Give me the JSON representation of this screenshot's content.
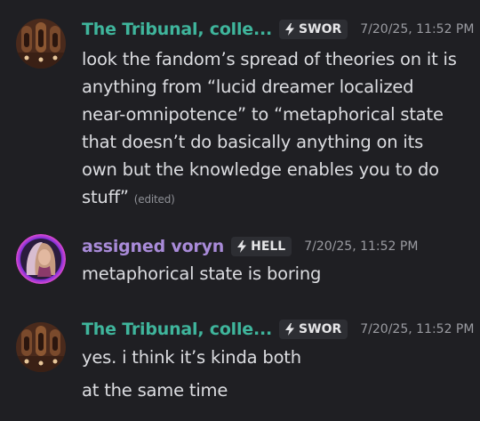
{
  "messages": [
    {
      "username": "The Tribunal, colle...",
      "username_color": "#3fb59c",
      "tag": "SWOR",
      "timestamp": "7/20/25, 11:52 PM",
      "lines": [
        "look the fandom’s spread of theories on it is",
        "anything from “lucid dreamer localized",
        "near-omnipotence” to “metaphorical state",
        "that doesn’t do basically anything on its",
        "own but the knowledge enables you to do",
        "stuff”"
      ],
      "edited": "(edited)"
    },
    {
      "username": "assigned voryn",
      "username_color": "#a98bd9",
      "tag": "HELL",
      "timestamp": "7/20/25, 11:52 PM",
      "lines": [
        "metaphorical state is boring"
      ]
    },
    {
      "username": "The Tribunal, colle...",
      "username_color": "#3fb59c",
      "tag": "SWOR",
      "timestamp": "7/20/25, 11:52 PM",
      "lines": [
        "yes. i think it’s kinda both"
      ]
    }
  ],
  "followup": "at the same time"
}
